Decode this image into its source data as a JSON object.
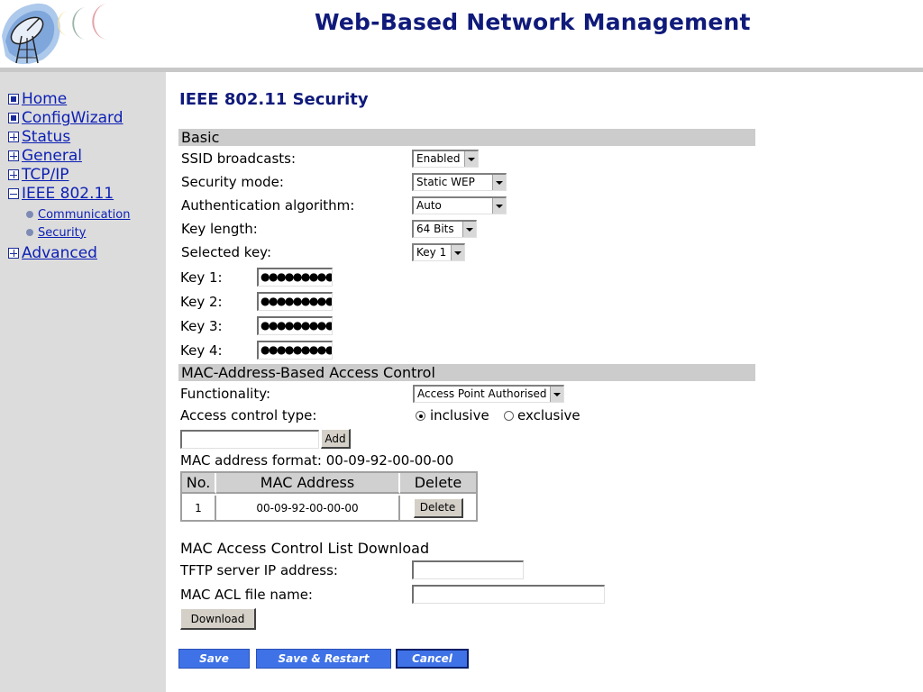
{
  "header": {
    "title": "Web-Based Network Management"
  },
  "sidebar": {
    "items": [
      {
        "label": "Home",
        "icon": "dot-box-icon"
      },
      {
        "label": "ConfigWizard",
        "icon": "dot-box-icon"
      },
      {
        "label": "Status",
        "icon": "plus-box-icon"
      },
      {
        "label": "General",
        "icon": "plus-box-icon"
      },
      {
        "label": "TCP/IP",
        "icon": "plus-box-icon"
      },
      {
        "label": "IEEE 802.11",
        "icon": "minus-box-icon"
      },
      {
        "label": "Advanced",
        "icon": "plus-box-icon"
      }
    ],
    "subitems": [
      {
        "label": "Communication"
      },
      {
        "label": "Security"
      }
    ]
  },
  "page": {
    "title": "IEEE 802.11 Security"
  },
  "basic": {
    "section_title": "Basic",
    "ssid_label": "SSID broadcasts:",
    "ssid_value": "Enabled",
    "security_mode_label": "Security mode:",
    "security_mode_value": "Static WEP",
    "auth_label": "Authentication algorithm:",
    "auth_value": "Auto",
    "key_length_label": "Key length:",
    "key_length_value": "64 Bits",
    "selected_key_label": "Selected key:",
    "selected_key_value": "Key 1",
    "keys": [
      {
        "label": "Key 1:",
        "value": "●●●●●●●●●●"
      },
      {
        "label": "Key 2:",
        "value": "●●●●●●●●●●"
      },
      {
        "label": "Key 3:",
        "value": "●●●●●●●●●●"
      },
      {
        "label": "Key 4:",
        "value": "●●●●●●●●●●"
      }
    ]
  },
  "mac_acl": {
    "section_title": "MAC-Address-Based Access Control",
    "functionality_label": "Functionality:",
    "functionality_value": "Access Point Authorised",
    "type_label": "Access control type:",
    "type_options": [
      "inclusive",
      "exclusive"
    ],
    "type_selected": "inclusive",
    "add_label": "Add",
    "address_input_value": "",
    "format_text": "MAC address format: 00-09-92-00-00-00",
    "table": {
      "headers": [
        "No.",
        "MAC Address",
        "Delete"
      ],
      "rows": [
        {
          "no": "1",
          "mac": "00-09-92-00-00-00",
          "delete_label": "Delete"
        }
      ]
    }
  },
  "download": {
    "section_title": "MAC Access Control List Download",
    "tftp_label": "TFTP server IP address:",
    "tftp_value": "",
    "file_label": "MAC ACL file name:",
    "file_value": "",
    "download_label": "Download"
  },
  "actions": {
    "save": "Save",
    "save_restart": "Save & Restart",
    "cancel": "Cancel"
  },
  "colors": {
    "title_navy": "#0f1a7a",
    "link_blue": "#0c1fb4",
    "action_blue": "#3f72e6",
    "sidebar_gray": "#dcdcdc"
  }
}
